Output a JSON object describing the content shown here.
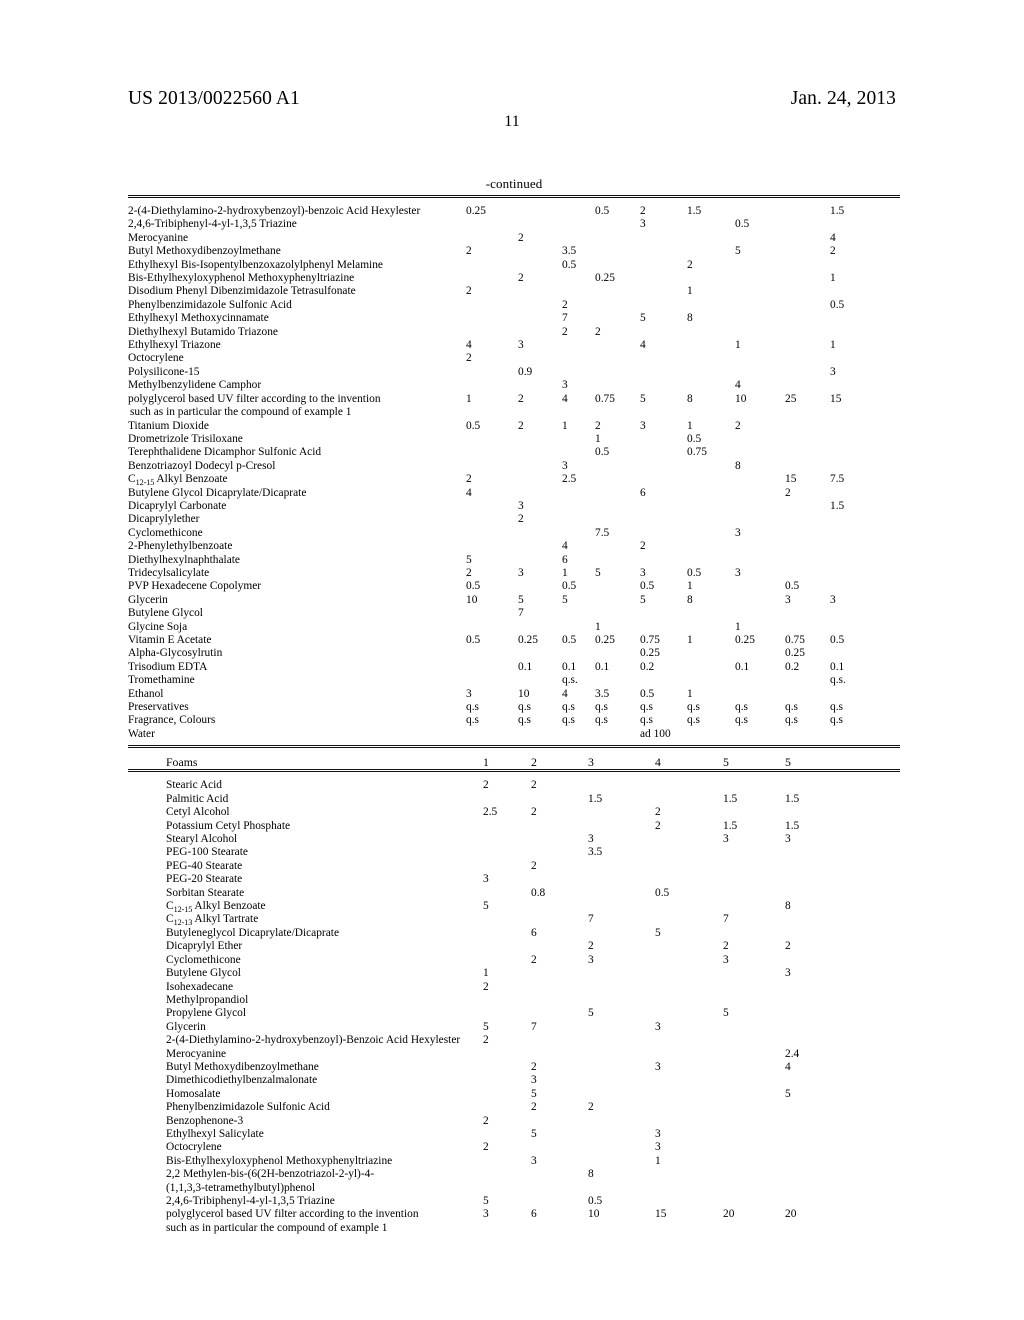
{
  "header": {
    "publication_number": "US 2013/0022560 A1",
    "publication_date": "Jan. 24, 2013",
    "page_number": "11"
  },
  "table_continued": {
    "caption": "-continued",
    "column_count": 9,
    "rows": [
      {
        "name": "2-(4-Diethylamino-2-hydroxybenzoyl)-benzoic Acid Hexylester",
        "values": [
          "0.25",
          "",
          "",
          "0.5",
          "2",
          "1.5",
          "",
          "",
          "1.5"
        ]
      },
      {
        "name": "2,4,6-Tribiphenyl-4-yl-1,3,5 Triazine",
        "values": [
          "",
          "",
          "",
          "",
          "3",
          "",
          "0.5",
          "",
          ""
        ]
      },
      {
        "name": "Merocyanine",
        "values": [
          "",
          "2",
          "",
          "",
          "",
          "",
          "",
          "",
          "4"
        ]
      },
      {
        "name": "Butyl Methoxydibenzoylmethane",
        "values": [
          "2",
          "",
          "3.5",
          "",
          "",
          "",
          "5",
          "",
          "2"
        ]
      },
      {
        "name": "Ethylhexyl Bis-Isopentylbenzoxazolylphenyl Melamine",
        "values": [
          "",
          "",
          "0.5",
          "",
          "",
          "2",
          "",
          "",
          ""
        ]
      },
      {
        "name": "Bis-Ethylhexyloxyphenol Methoxyphenyltriazine",
        "values": [
          "",
          "2",
          "",
          "0.25",
          "",
          "",
          "",
          "",
          "1"
        ]
      },
      {
        "name": "Disodium Phenyl Dibenzimidazole Tetrasulfonate",
        "values": [
          "2",
          "",
          "",
          "",
          "",
          "1",
          "",
          "",
          ""
        ]
      },
      {
        "name": "Phenylbenzimidazole Sulfonic Acid",
        "values": [
          "",
          "",
          "2",
          "",
          "",
          "",
          "",
          "",
          "0.5"
        ]
      },
      {
        "name": "Ethylhexyl Methoxycinnamate",
        "values": [
          "",
          "",
          "7",
          "",
          "5",
          "8",
          "",
          "",
          ""
        ]
      },
      {
        "name": "Diethylhexyl Butamido Triazone",
        "values": [
          "",
          "",
          "2",
          "2",
          "",
          "",
          "",
          "",
          ""
        ]
      },
      {
        "name": "Ethylhexyl Triazone",
        "values": [
          "4",
          "3",
          "",
          "",
          "4",
          "",
          "1",
          "",
          "1"
        ]
      },
      {
        "name": "Octocrylene",
        "values": [
          "2",
          "",
          "",
          "",
          "",
          "",
          "",
          "",
          ""
        ]
      },
      {
        "name": "Polysilicone-15",
        "values": [
          "",
          "0.9",
          "",
          "",
          "",
          "",
          "",
          "",
          "3"
        ]
      },
      {
        "name": "Methylbenzylidene Camphor",
        "values": [
          "",
          "",
          "3",
          "",
          "",
          "",
          "4",
          "",
          ""
        ]
      },
      {
        "name": "polyglycerol based UV filter according to the invention",
        "continuation": "such as in particular the compound of example 1",
        "values": [
          "1",
          "2",
          "4",
          "0.75",
          "5",
          "8",
          "10",
          "25",
          "15"
        ]
      },
      {
        "name": "Titanium Dioxide",
        "values": [
          "0.5",
          "2",
          "1",
          "2",
          "3",
          "1",
          "2",
          "",
          ""
        ]
      },
      {
        "name": "Drometrizole Trisiloxane",
        "values": [
          "",
          "",
          "",
          "1",
          "",
          "0.5",
          "",
          "",
          ""
        ]
      },
      {
        "name": "Terephthalidene Dicamphor Sulfonic Acid",
        "values": [
          "",
          "",
          "",
          "0.5",
          "",
          "0.75",
          "",
          "",
          ""
        ]
      },
      {
        "name": "Benzotriazoyl Dodecyl p-Cresol",
        "values": [
          "",
          "",
          "3",
          "",
          "",
          "",
          "8",
          "",
          ""
        ]
      },
      {
        "name": "C12-15 Alkyl Benzoate",
        "name_prefix": "C",
        "name_sub": "12-15",
        "name_suffix": " Alkyl Benzoate",
        "values": [
          "2",
          "",
          "2.5",
          "",
          "",
          "",
          "",
          "15",
          "7.5"
        ]
      },
      {
        "name": "Butylene Glycol Dicaprylate/Dicaprate",
        "values": [
          "4",
          "",
          "",
          "",
          "6",
          "",
          "",
          "2",
          ""
        ]
      },
      {
        "name": "Dicaprylyl Carbonate",
        "values": [
          "",
          "3",
          "",
          "",
          "",
          "",
          "",
          "",
          "1.5"
        ]
      },
      {
        "name": "Dicaprylylether",
        "values": [
          "",
          "2",
          "",
          "",
          "",
          "",
          "",
          "",
          ""
        ]
      },
      {
        "name": "Cyclomethicone",
        "values": [
          "",
          "",
          "",
          "7.5",
          "",
          "",
          "3",
          "",
          ""
        ]
      },
      {
        "name": "2-Phenylethylbenzoate",
        "values": [
          "",
          "",
          "4",
          "",
          "2",
          "",
          "",
          "",
          ""
        ]
      },
      {
        "name": "Diethylhexylnaphthalate",
        "values": [
          "5",
          "",
          "6",
          "",
          "",
          "",
          "",
          "",
          ""
        ]
      },
      {
        "name": "Tridecylsalicylate",
        "values": [
          "2",
          "3",
          "1",
          "5",
          "3",
          "0.5",
          "3",
          "",
          ""
        ]
      },
      {
        "name": "PVP Hexadecene Copolymer",
        "values": [
          "0.5",
          "",
          "0.5",
          "",
          "0.5",
          "1",
          "",
          "0.5",
          ""
        ]
      },
      {
        "name": "Glycerin",
        "values": [
          "10",
          "5",
          "5",
          "",
          "5",
          "8",
          "",
          "3",
          "3"
        ]
      },
      {
        "name": "Butylene Glycol",
        "values": [
          "",
          "7",
          "",
          "",
          "",
          "",
          "",
          "",
          ""
        ]
      },
      {
        "name": "Glycine Soja",
        "values": [
          "",
          "",
          "",
          "1",
          "",
          "",
          "1",
          "",
          ""
        ]
      },
      {
        "name": "Vitamin E Acetate",
        "values": [
          "0.5",
          "0.25",
          "0.5",
          "0.25",
          "0.75",
          "1",
          "0.25",
          "0.75",
          "0.5"
        ]
      },
      {
        "name": "Alpha-Glycosylrutin",
        "values": [
          "",
          "",
          "",
          "",
          "0.25",
          "",
          "",
          "0.25",
          ""
        ]
      },
      {
        "name": "Trisodium EDTA",
        "values": [
          "",
          "0.1",
          "0.1",
          "0.1",
          "0.2",
          "",
          "0.1",
          "0.2",
          "0.1"
        ]
      },
      {
        "name": "Tromethamine",
        "values": [
          "",
          "",
          "q.s.",
          "",
          "",
          "",
          "",
          "",
          "q.s."
        ]
      },
      {
        "name": "Ethanol",
        "values": [
          "3",
          "10",
          "4",
          "3.5",
          "0.5",
          "1",
          "",
          "",
          ""
        ]
      },
      {
        "name": "Preservatives",
        "values": [
          "q.s",
          "q.s",
          "q.s",
          "q.s",
          "q.s",
          "q.s",
          "q.s",
          "q.s",
          "q.s"
        ]
      },
      {
        "name": "Fragrance, Colours",
        "values": [
          "q.s",
          "q.s",
          "q.s",
          "q.s",
          "q.s",
          "q.s",
          "q.s",
          "q.s",
          "q.s"
        ]
      },
      {
        "name": "Water",
        "values": [
          "",
          "",
          "",
          "",
          "ad 100",
          "",
          "",
          "",
          ""
        ]
      }
    ]
  },
  "table_foams": {
    "header_label": "Foams",
    "columns": [
      "1",
      "2",
      "3",
      "4",
      "5",
      "5"
    ],
    "rows": [
      {
        "name": "Stearic Acid",
        "values": [
          "2",
          "2",
          "",
          "",
          "",
          ""
        ]
      },
      {
        "name": "Palmitic Acid",
        "values": [
          "",
          "",
          "1.5",
          "",
          "1.5",
          "1.5"
        ]
      },
      {
        "name": "Cetyl Alcohol",
        "values": [
          "2.5",
          "2",
          "",
          "2",
          "",
          ""
        ]
      },
      {
        "name": "Potassium Cetyl Phosphate",
        "values": [
          "",
          "",
          "",
          "2",
          "1.5",
          "1.5"
        ]
      },
      {
        "name": "Stearyl Alcohol",
        "values": [
          "",
          "",
          "3",
          "",
          "3",
          "3"
        ]
      },
      {
        "name": "PEG-100 Stearate",
        "values": [
          "",
          "",
          "3.5",
          "",
          "",
          ""
        ]
      },
      {
        "name": "PEG-40 Stearate",
        "values": [
          "",
          "2",
          "",
          "",
          "",
          ""
        ]
      },
      {
        "name": "PEG-20 Stearate",
        "values": [
          "3",
          "",
          "",
          "",
          "",
          ""
        ]
      },
      {
        "name": "Sorbitan Stearate",
        "values": [
          "",
          "0.8",
          "",
          "0.5",
          "",
          ""
        ]
      },
      {
        "name": "C12-15 Alkyl Benzoate",
        "name_prefix": "C",
        "name_sub": "12-15",
        "name_suffix": " Alkyl Benzoate",
        "values": [
          "5",
          "",
          "",
          "",
          "",
          "8"
        ]
      },
      {
        "name": "C12-13 Alkyl Tartrate",
        "name_prefix": "C",
        "name_sub": "12-13",
        "name_suffix": " Alkyl Tartrate",
        "values": [
          "",
          "",
          "7",
          "",
          "7",
          ""
        ]
      },
      {
        "name": "Butyleneglycol Dicaprylate/Dicaprate",
        "values": [
          "",
          "6",
          "",
          "5",
          "",
          ""
        ]
      },
      {
        "name": "Dicaprylyl Ether",
        "values": [
          "",
          "",
          "2",
          "",
          "2",
          "2"
        ]
      },
      {
        "name": "Cyclomethicone",
        "values": [
          "",
          "2",
          "3",
          "",
          "3",
          ""
        ]
      },
      {
        "name": "Butylene Glycol",
        "values": [
          "1",
          "",
          "",
          "",
          "",
          "3"
        ]
      },
      {
        "name": "Isohexadecane",
        "values": [
          "2",
          "",
          "",
          "",
          "",
          ""
        ]
      },
      {
        "name": "Methylpropandiol",
        "values": [
          "",
          "",
          "",
          "",
          "",
          ""
        ]
      },
      {
        "name": "Propylene Glycol",
        "values": [
          "",
          "",
          "5",
          "",
          "5",
          ""
        ]
      },
      {
        "name": "Glycerin",
        "values": [
          "5",
          "7",
          "",
          "3",
          "",
          ""
        ]
      },
      {
        "name": "2-(4-Diethylamino-2-hydroxybenzoyl)-Benzoic Acid Hexylester",
        "values": [
          "2",
          "",
          "",
          "",
          "",
          ""
        ]
      },
      {
        "name": "Merocyanine",
        "values": [
          "",
          "",
          "",
          "",
          "",
          "2.4"
        ]
      },
      {
        "name": "Butyl Methoxydibenzoylmethane",
        "values": [
          "",
          "2",
          "",
          "3",
          "",
          "4"
        ]
      },
      {
        "name": "Dimethicodiethylbenzalmalonate",
        "values": [
          "",
          "3",
          "",
          "",
          "",
          ""
        ]
      },
      {
        "name": "Homosalate",
        "values": [
          "",
          "5",
          "",
          "",
          "",
          "5"
        ]
      },
      {
        "name": "Phenylbenzimidazole Sulfonic Acid",
        "values": [
          "",
          "2",
          "2",
          "",
          "",
          ""
        ]
      },
      {
        "name": "Benzophenone-3",
        "values": [
          "2",
          "",
          "",
          "",
          "",
          ""
        ]
      },
      {
        "name": "Ethylhexyl Salicylate",
        "values": [
          "",
          "5",
          "",
          "3",
          "",
          ""
        ]
      },
      {
        "name": "Octocrylene",
        "values": [
          "2",
          "",
          "",
          "3",
          "",
          ""
        ]
      },
      {
        "name": "Bis-Ethylhexyloxyphenol Methoxyphenyltriazine",
        "values": [
          "",
          "3",
          "",
          "1",
          "",
          ""
        ]
      },
      {
        "name": "2,2 Methylen-bis-(6(2H-benzotriazol-2-yl)-4-",
        "continuation": "(1,1,3,3-tetramethylbutyl)phenol",
        "values": [
          "",
          "",
          "8",
          "",
          "",
          ""
        ]
      },
      {
        "name": "2,4,6-Tribiphenyl-4-yl-1,3,5 Triazine",
        "values": [
          "5",
          "",
          "0.5",
          "",
          "",
          ""
        ]
      },
      {
        "name": "polyglycerol based UV filter according to the invention",
        "continuation": "such as in particular the compound of example 1",
        "values": [
          "3",
          "6",
          "10",
          "15",
          "20",
          "20"
        ]
      }
    ]
  }
}
